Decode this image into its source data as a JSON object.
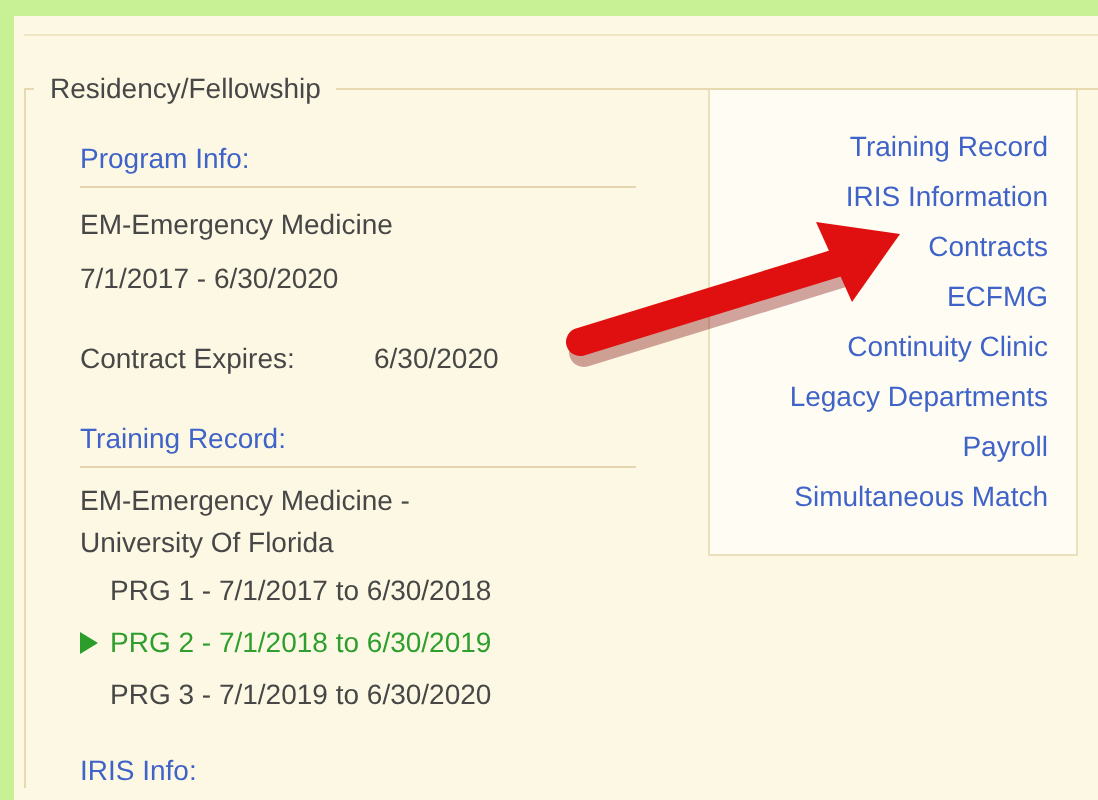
{
  "section": {
    "title": "Residency/Fellowship"
  },
  "program_info": {
    "heading": "Program Info:",
    "lines": [
      "EM-Emergency Medicine",
      "7/1/2017 - 6/30/2020"
    ]
  },
  "contract": {
    "label": "Contract Expires:",
    "value": "6/30/2020"
  },
  "training_record": {
    "heading": "Training Record:",
    "lines": [
      "EM-Emergency Medicine -",
      "University Of Florida"
    ],
    "periods": [
      {
        "text": "PRG 1 - 7/1/2017 to 6/30/2018",
        "selected": false
      },
      {
        "text": "PRG 2 - 7/1/2018 to 6/30/2019",
        "selected": true
      },
      {
        "text": "PRG 3 - 7/1/2019 to 6/30/2020",
        "selected": false
      }
    ]
  },
  "iris_info": {
    "heading": "IRIS Info:"
  },
  "links": [
    "Training Record",
    "IRIS Information",
    "Contracts",
    "ECFMG",
    "Continuity Clinic",
    "Legacy Departments",
    "Payroll",
    "Simultaneous Match"
  ]
}
